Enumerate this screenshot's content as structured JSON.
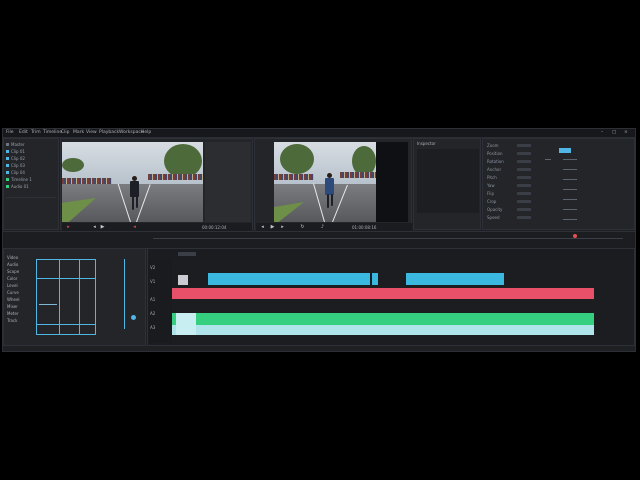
{
  "menu": [
    "File",
    "Edit",
    "Trim",
    "Timeline",
    "Clip",
    "Mark",
    "View",
    "Playback",
    "Workspace",
    "Help"
  ],
  "window_controls": [
    "–",
    "□",
    "×"
  ],
  "media_pool": {
    "items": [
      "Master",
      "Clip 01",
      "Clip 02",
      "Clip 03",
      "Clip 04",
      "Timeline 1",
      "Audio 01"
    ]
  },
  "source_viewer": {
    "timecode": "00:00:12:04"
  },
  "program_viewer": {
    "timecode": "01:00:08:16"
  },
  "inspector": {
    "title": "Inspector",
    "props": [
      "Zoom",
      "Position",
      "Rotation",
      "Anchor",
      "Pitch",
      "Yaw",
      "Flip",
      "Crop",
      "Opacity",
      "Speed"
    ]
  },
  "scopes": {
    "items": [
      "Video",
      "Audio",
      "Scope",
      "Color",
      "Level",
      "Curve",
      "Wheel",
      "Mixer",
      "Meter",
      "Track"
    ]
  },
  "timeline": {
    "tracks": [
      "V2",
      "V1",
      "A1",
      "A2",
      "A3"
    ],
    "colors": {
      "video": "#3bb8e0",
      "title": "#e8506a",
      "audio": "#35d07f",
      "audio2": "#aee4ea"
    }
  }
}
